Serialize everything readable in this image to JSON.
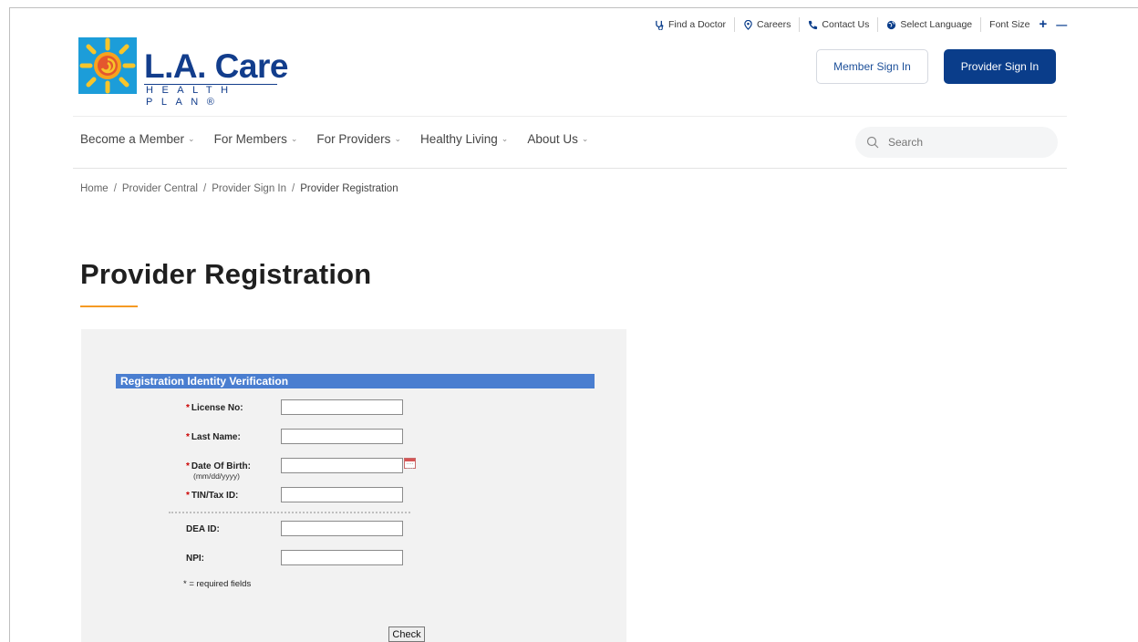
{
  "utility": {
    "find_doctor": "Find a Doctor",
    "careers": "Careers",
    "contact_us": "Contact Us",
    "select_language": "Select Language",
    "font_size": "Font Size",
    "font_increase": "+",
    "font_decrease": "—"
  },
  "logo": {
    "name": "L.A. Care",
    "sub": "HEALTH PLAN®"
  },
  "header": {
    "member_sign_in": "Member Sign In",
    "provider_sign_in": "Provider Sign In"
  },
  "nav": {
    "items": [
      {
        "label": "Become a Member"
      },
      {
        "label": "For Members"
      },
      {
        "label": "For Providers"
      },
      {
        "label": "Healthy Living"
      },
      {
        "label": "About Us"
      }
    ],
    "search_placeholder": "Search"
  },
  "breadcrumb": {
    "items": [
      "Home",
      "Provider Central",
      "Provider Sign In",
      "Provider Registration"
    ],
    "separator": "/"
  },
  "page": {
    "title": "Provider Registration"
  },
  "form": {
    "header": "Registration Identity Verification",
    "required_marker": "*",
    "fields": {
      "license": {
        "label": "License No:",
        "value": ""
      },
      "last_name": {
        "label": "Last Name:",
        "value": ""
      },
      "dob": {
        "label": "Date Of Birth:",
        "hint": "(mm/dd/yyyy)",
        "value": ""
      },
      "tin": {
        "label": "TIN/Tax ID:",
        "value": ""
      },
      "dea": {
        "label": "DEA ID:",
        "value": ""
      },
      "npi": {
        "label": "NPI:",
        "value": ""
      }
    },
    "required_note": "* = required fields",
    "submit": "Check"
  },
  "colors": {
    "brand_navy": "#0a3d8a",
    "accent_orange": "#f59a23",
    "form_header_blue": "#4a7ed0",
    "logo_blue": "#1c9dd9"
  }
}
